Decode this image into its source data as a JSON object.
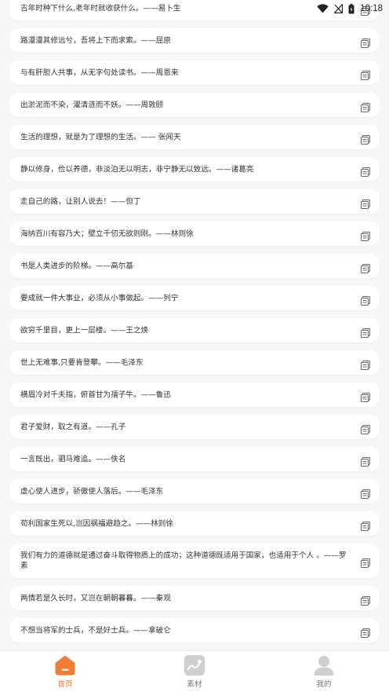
{
  "status_bar": {
    "time": "10:18"
  },
  "colors": {
    "accent": "#f07c36",
    "inactive_icon": "#cfcfcf",
    "background": "#f7f7f7"
  },
  "quotes": [
    {
      "text": "吉年时种下什么,老年时就收获什么。——易卜生"
    },
    {
      "text": "路漫漫其修远兮，吾将上下而求索。——屈原"
    },
    {
      "text": "与有肝胆人共事，从无字句处读书。——周恩来"
    },
    {
      "text": "出淤泥而不染，濯清涟而不妖。——周敦颐"
    },
    {
      "text": "生活的理想，就是为了理想的生活。—— 张闻天"
    },
    {
      "text": "静以修身，俭以养德，非淡泊无以明志，非宁静无以致远。——诸葛亮"
    },
    {
      "text": "走自己的路，让别人说去！——但丁"
    },
    {
      "text": "海纳百川有容乃大；壁立千仞无欲则刚。——林则徐"
    },
    {
      "text": "书是人类进步的阶梯。——高尔基"
    },
    {
      "text": "要成就一件大事业，必须从小事做起。——列宁"
    },
    {
      "text": "欲穷千里目，更上一层楼。——王之焕"
    },
    {
      "text": "世上无难事,只要肯登攀。——毛泽东"
    },
    {
      "text": "横眉冷对千夫指，俯首甘为孺子牛。——鲁迅"
    },
    {
      "text": "君子爱财，取之有道。——孔子"
    },
    {
      "text": "一言既出，驷马难追。——佚名"
    },
    {
      "text": "虚心使人进步，骄傲使人落后。——毛泽东"
    },
    {
      "text": "苟利国家生死以,岂因祸福避趋之。——林则徐"
    },
    {
      "text": "我们有力的道德就是通过奋斗取得物质上的成功；这种道德既适用于国家，也适用于个人 。——罗素"
    },
    {
      "text": "两情若是久长时，又岂在朝朝暮暮。——秦观"
    },
    {
      "text": "不想当将军的士兵，不是好士兵。——拿破仑"
    }
  ],
  "tabs": [
    {
      "label": "首页",
      "icon": "home-icon",
      "active": true
    },
    {
      "label": "素材",
      "icon": "image-icon",
      "active": false
    },
    {
      "label": "我的",
      "icon": "user-icon",
      "active": false
    }
  ]
}
